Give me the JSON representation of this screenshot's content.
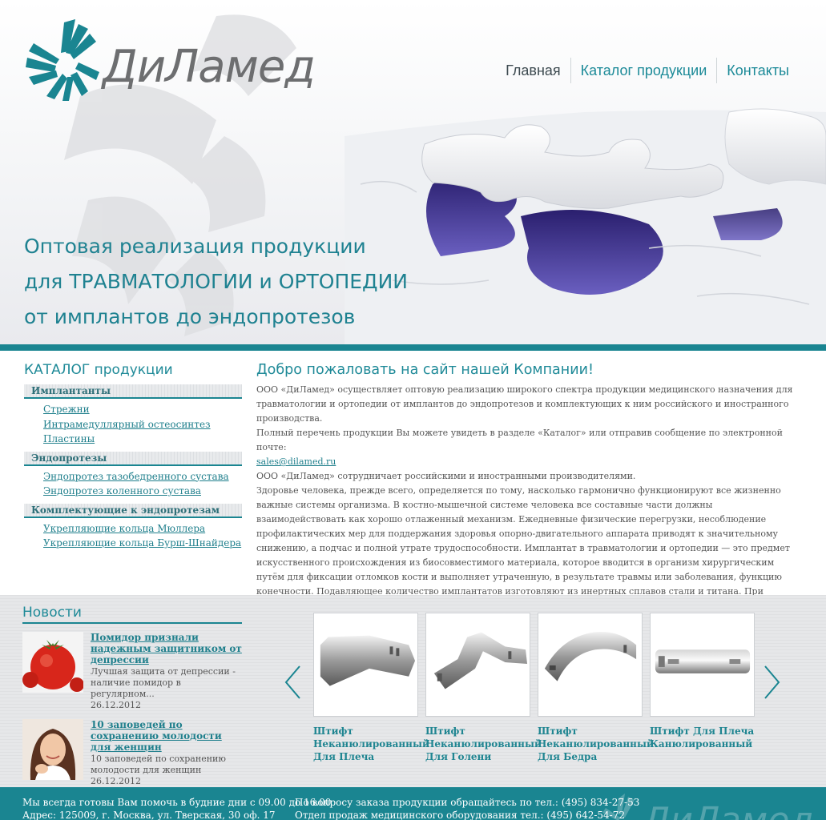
{
  "header": {
    "logo_text": "ДиЛамед",
    "nav": [
      "Главная",
      "Каталог продукции",
      "Контакты"
    ],
    "slogan": [
      "Оптовая реализация продукции",
      "для ТРАВМАТОЛОГИИ и ОРТОПЕДИИ",
      "от имплантов до эндопротезов"
    ]
  },
  "catalog": {
    "title": "КАТАЛОГ продукции",
    "groups": [
      {
        "label": "Имплантанты",
        "items": [
          "Стрежни",
          "Интрамедуллярный остеосинтез",
          "Пластины"
        ]
      },
      {
        "label": "Эндопротезы",
        "items": [
          "Эндопротез тазобедренного сустава",
          "Эндопротез коленного сустава"
        ]
      },
      {
        "label": "Комплектующие к эндопротезам",
        "items": [
          "Укрепляющие кольца Мюллера",
          "Укрепляющие кольца Бурш-Шнайдера"
        ]
      }
    ]
  },
  "welcome": {
    "title": "Добро пожаловать на сайт нашей Компании!",
    "p1": "ООО «ДиЛамед» осуществляет оптовую реализацию широкого спектра  продукции медицинского назначения для травматологии и ортопедии от имплантов до эндопротезов и комплектующих к ним российского и иностранного производства.",
    "p2": "Полный перечень продукции Вы можете увидеть в разделе «Каталог» или отправив сообщение по электронной почте:",
    "email": "sales@dilamed.ru",
    "p3": "ООО «ДиЛамед» сотрудничает российскими  и иностранными производителями.",
    "p4": "Здоровье человека, прежде всего, определяется по тому, насколько гармонично функционируют все жизненно важные системы организма. В костно-мышечной системе человека все составные части должны взаимодействовать как хорошо отлаженный механизм. Ежедневные физические перегрузки, несоблюдение профилактических мер для поддержания здоровья опорно-двигательного аппарата приводят к значительному снижению, а подчас и полной утрате трудоспособности. Имплантат в травматологии и ортопедии — это предмет искусственного происхождения из биосовместимого материала, которое вводится в организм хирургическим путём для фиксации отломков кости и выполняет утраченную, в результате травмы или заболевания, функцию конечности. Подавляющее количество имплантатов изготовляют из инертных сплавов стали и титана. При изготовлении имплантов используются космические технологии, с помощью которых достигается высокая точность и повышенная надежность металлоконструкции."
  },
  "news": {
    "title": "Новости",
    "items": [
      {
        "title": "Помидор признали надежным защитником от депрессии",
        "text": "Лучшая защита от депрессии - наличие помидор в регулярном...",
        "date": "26.12.2012"
      },
      {
        "title": "10 заповедей по сохранению молодости для женщин",
        "text": "10 заповедей по сохранению молодости для женщин",
        "date": "26.12.2012"
      }
    ]
  },
  "products": [
    {
      "name": "Штифт Неканюлированный Для Плеча"
    },
    {
      "name": "Штифт Неканюлированный Для Голени"
    },
    {
      "name": "Штифт Неканюлированный Для Бедра"
    },
    {
      "name": "Штифт Для Плеча Канюлированный"
    }
  ],
  "footer": {
    "line1": "Мы всегда готовы Вам помочь в будние дни с 09.00 до 16.00",
    "line2": "Адрес: 125009, г. Москва, ул. Тверская, 30 оф. 17",
    "line3": "По вопросу заказа продукции обращайтесь по тел.: (495) 834-27-53",
    "line4": "Отдел продаж медицинского оборудования тел.: (495) 642-54-72",
    "logo_text": "ДиЛамед"
  },
  "colors": {
    "accent": "#1a8591",
    "text": "#555555",
    "logo_gray": "#6d6e70"
  }
}
